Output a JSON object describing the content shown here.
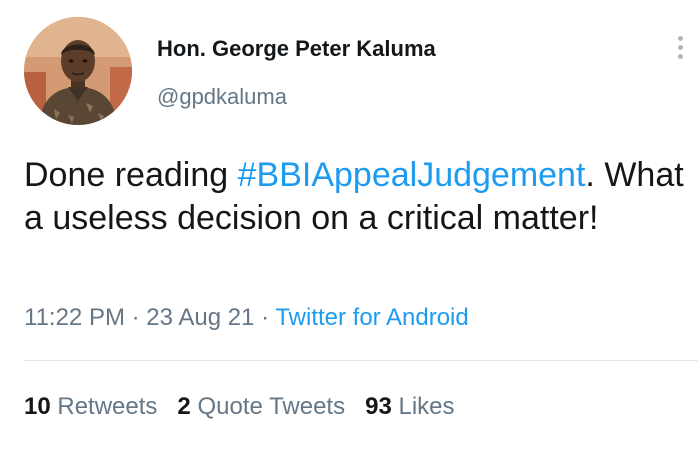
{
  "tweet": {
    "author": {
      "display_name": "Hon. George Peter Kaluma",
      "handle": "@gpdkaluma"
    },
    "text": {
      "before": "Done reading ",
      "hashtag": "#BBIAppealJudgement",
      "after": ". What a useless decision on a critical matter!"
    },
    "time": "11:22 PM",
    "separator": "·",
    "date": "23 Aug 21",
    "source": "Twitter for Android",
    "stats": {
      "retweets_count": "10",
      "retweets_label": "Retweets",
      "quote_count": "2",
      "quote_label": "Quote Tweets",
      "likes_count": "93",
      "likes_label": "Likes"
    }
  },
  "colors": {
    "link": "#1d9bf0",
    "secondary_text": "#657786",
    "primary_text": "#14171a",
    "divider": "#e1e8ed"
  },
  "icons": {
    "more": "more-vertical-icon"
  }
}
